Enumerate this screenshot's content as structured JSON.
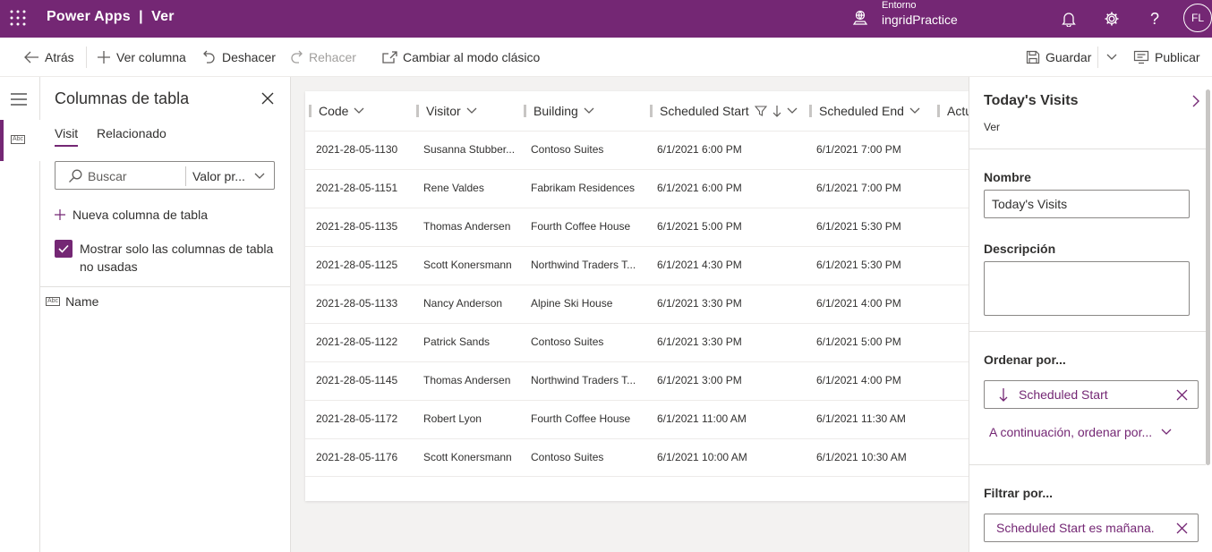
{
  "topbar": {
    "app_title": "Power Apps  |  Ver",
    "environment_label": "Entorno",
    "environment_name": "ingridPractice",
    "avatar_initials": "FL"
  },
  "commandbar": {
    "back": "Atrás",
    "add_column": "Ver columna",
    "undo": "Deshacer",
    "redo": "Rehacer",
    "classic": "Cambiar al modo clásico",
    "save": "Guardar",
    "publish": "Publicar"
  },
  "columns_panel": {
    "title": "Columnas de tabla",
    "tabs": [
      {
        "label": "Visit"
      },
      {
        "label": "Relacionado"
      }
    ],
    "search_placeholder": "Buscar",
    "search_filter": "Valor pr...",
    "new_column": "Nueva columna de tabla",
    "show_unused": "Mostrar solo las columnas de tabla no usadas",
    "fields": [
      {
        "label": "Name"
      }
    ]
  },
  "grid": {
    "headers": [
      "Code",
      "Visitor",
      "Building",
      "Scheduled Start",
      "Scheduled End",
      "Actu"
    ],
    "rows": [
      [
        "2021-28-05-1130",
        "Susanna Stubber...",
        "Contoso Suites",
        "6/1/2021 6:00 PM",
        "6/1/2021 7:00 PM"
      ],
      [
        "2021-28-05-1151",
        "Rene Valdes",
        "Fabrikam Residences",
        "6/1/2021 6:00 PM",
        "6/1/2021 7:00 PM"
      ],
      [
        "2021-28-05-1135",
        "Thomas Andersen",
        "Fourth Coffee House",
        "6/1/2021 5:00 PM",
        "6/1/2021 5:30 PM"
      ],
      [
        "2021-28-05-1125",
        "Scott Konersmann",
        "Northwind Traders T...",
        "6/1/2021 4:30 PM",
        "6/1/2021 5:30 PM"
      ],
      [
        "2021-28-05-1133",
        "Nancy Anderson",
        "Alpine Ski House",
        "6/1/2021 3:30 PM",
        "6/1/2021 4:00 PM"
      ],
      [
        "2021-28-05-1122",
        "Patrick Sands",
        "Contoso Suites",
        "6/1/2021 3:30 PM",
        "6/1/2021 5:00 PM"
      ],
      [
        "2021-28-05-1145",
        "Thomas Andersen",
        "Northwind Traders T...",
        "6/1/2021 3:00 PM",
        "6/1/2021 4:00 PM"
      ],
      [
        "2021-28-05-1172",
        "Robert Lyon",
        "Fourth Coffee House",
        "6/1/2021 11:00 AM",
        "6/1/2021 11:30 AM"
      ],
      [
        "2021-28-05-1176",
        "Scott Konersmann",
        "Contoso Suites",
        "6/1/2021 10:00 AM",
        "6/1/2021 10:30 AM"
      ]
    ]
  },
  "properties": {
    "title": "Today's Visits",
    "subtitle": "Ver",
    "name_label": "Nombre",
    "name_value": "Today's Visits",
    "description_label": "Descripción",
    "description_value": "",
    "sort_label": "Ordenar por...",
    "sort_value": "Scheduled Start",
    "then_sort": "A continuación, ordenar por...",
    "filter_label": "Filtrar por...",
    "filter_value": "Scheduled Start es mañana."
  },
  "colors": {
    "brand": "#742774",
    "background": "#f3f2f1"
  },
  "icons": [
    "waffle-icon",
    "environment-icon",
    "bell-icon",
    "gear-icon",
    "help-icon",
    "back-arrow-icon",
    "plus-icon",
    "undo-icon",
    "redo-icon",
    "switch-classic-icon",
    "save-icon",
    "chevron-down-icon",
    "publish-icon",
    "hamburger-icon",
    "text-field-icon",
    "close-icon",
    "search-icon",
    "checkbox-icon",
    "filter-icon",
    "sort-down-icon",
    "chevron-right-icon"
  ]
}
